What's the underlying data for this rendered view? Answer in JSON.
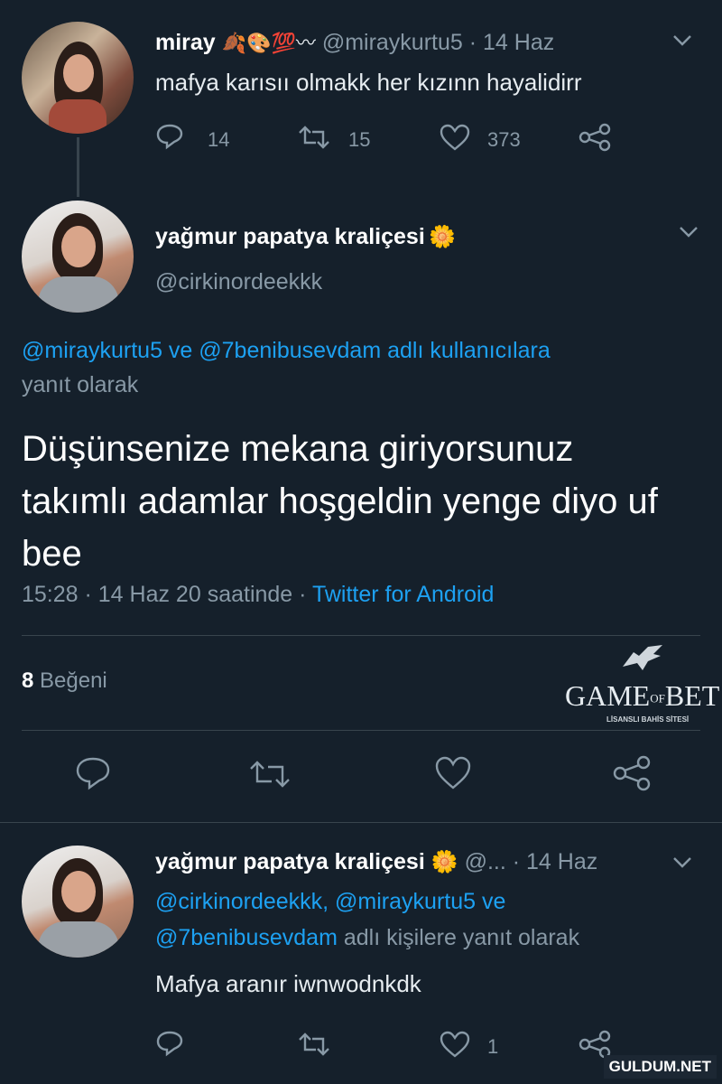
{
  "tweet1": {
    "name": "miray",
    "emoji": "🍂🎨💯〰",
    "handle": "@miraykurtu5",
    "date": "· 14 Haz",
    "text": "mafya karısıı olmakk her kızınn hayalidirr",
    "replies": "14",
    "retweets": "15",
    "likes": "373"
  },
  "tweet2": {
    "name": "yağmur papatya kraliçesi",
    "flower": "🌼",
    "handle": "@cirkinordeekkk",
    "reply_mentions": "@miraykurtu5 ve @7benibusevdam",
    "reply_suffix": "adlı kullanıcılara",
    "reply_line2": "yanıt olarak",
    "text": "Düşünsenize mekana giriyorsunuz takımlı adamlar hoşgeldin yenge diyo uf bee",
    "timestamp": "15:28 · 14 Haz 20 saatinde ·",
    "source": "Twitter for Android",
    "likes_count": "8",
    "likes_label": "Beğeni"
  },
  "tweet3": {
    "name": "yağmur papatya kraliçesi",
    "flower": "🌼",
    "handle_trunc": "@...",
    "date": "· 14 Haz",
    "mention_line1": "@cirkinordeekkk, @miraykurtu5 ve",
    "mention_line2": "@7benibusevdam",
    "reply_suffix": "adlı kişilere yanıt olarak",
    "text": "Mafya aranır iwnwodnkdk",
    "likes": "1"
  },
  "watermark": {
    "brand": "GAME OF BET",
    "brand_of": "OF",
    "brand_game": "GAME",
    "brand_bet": "BET",
    "tagline": "LİSANSLI BAHİS SİTESİ",
    "site": "GULDUM.NET"
  },
  "colors": {
    "background": "#15202b",
    "link": "#1da1f2",
    "muted": "#8899a6"
  }
}
